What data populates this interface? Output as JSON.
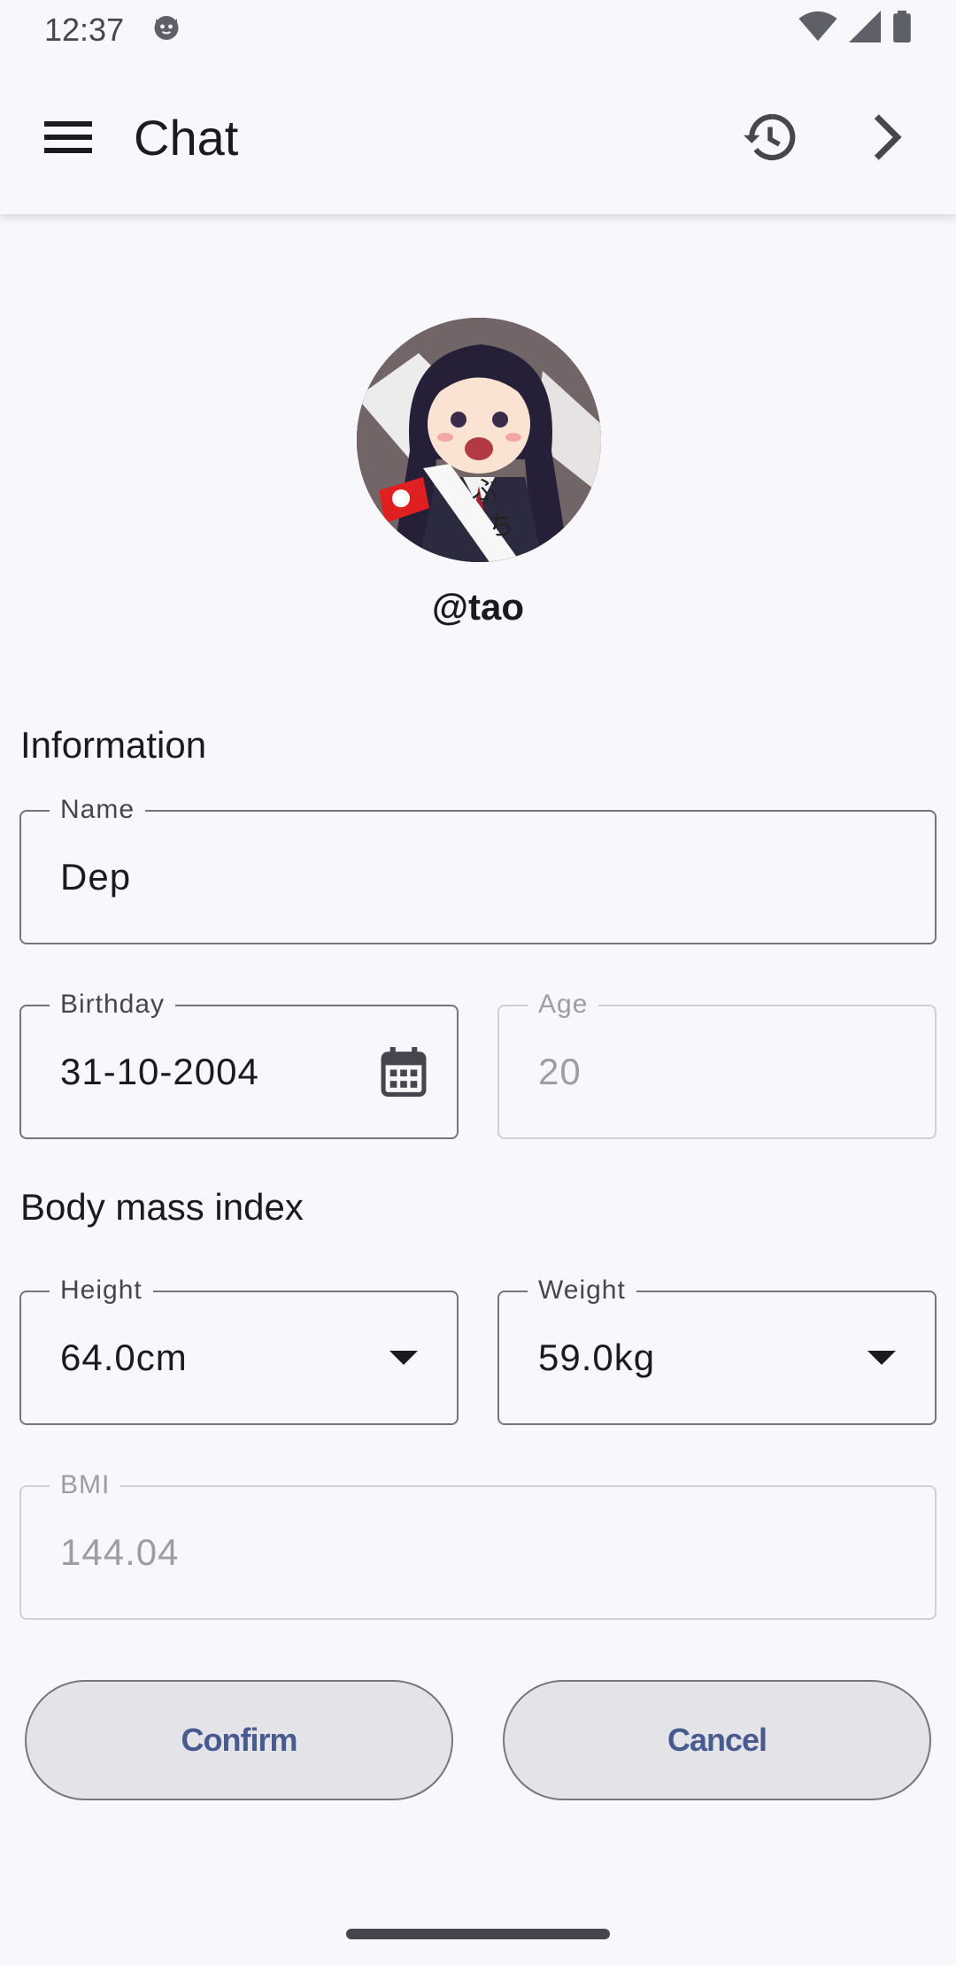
{
  "status_bar": {
    "time": "12:37",
    "icons": [
      "cat-notification-icon",
      "wifi-icon",
      "signal-icon",
      "battery-icon"
    ]
  },
  "app_bar": {
    "title": "Chat",
    "menu_icon": "menu-icon",
    "history_icon": "history-icon",
    "next_icon": "chevron-right-icon"
  },
  "profile": {
    "username": "@tao"
  },
  "information": {
    "title": "Information",
    "name": {
      "label": "Name",
      "value": "Dep"
    },
    "birthday": {
      "label": "Birthday",
      "value": "31-10-2004",
      "icon": "calendar-icon"
    },
    "age": {
      "label": "Age",
      "value": "20"
    }
  },
  "bmi_section": {
    "title": "Body mass index",
    "height": {
      "label": "Height",
      "value": "64.0cm",
      "icon": "dropdown-arrow-icon"
    },
    "weight": {
      "label": "Weight",
      "value": "59.0kg",
      "icon": "dropdown-arrow-icon"
    },
    "bmi": {
      "label": "BMI",
      "value": "144.04"
    }
  },
  "actions": {
    "confirm": "Confirm",
    "cancel": "Cancel"
  },
  "colors": {
    "background": "#f8f7fc",
    "button_text": "#485b91",
    "button_bg": "#e4e3e8",
    "outline": "#74747e"
  }
}
